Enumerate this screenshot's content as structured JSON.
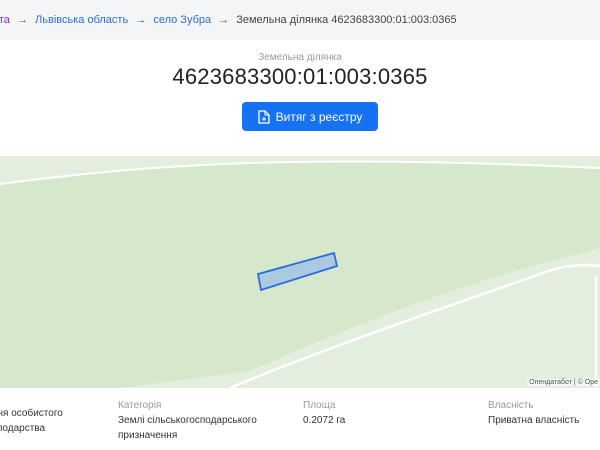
{
  "breadcrumb": {
    "items": [
      "ота",
      "Львівська область",
      "село Зубра"
    ],
    "current": "Земельна ділянка 4623683300:01:003:0365",
    "separator": "→"
  },
  "header": {
    "subtitle": "Земельна ділянка",
    "cadastral_number": "4623683300:01:003:0365",
    "extract_button_label": "Витяг з реєстру"
  },
  "map": {
    "attribution": "Опендатабот | © Ope"
  },
  "details": {
    "purpose": {
      "value_line1": "ння особистого",
      "value_line2": "сподарства"
    },
    "category": {
      "label": "Категорія",
      "value_line1": "Землі сільськогосподарського",
      "value_line2": "призначення"
    },
    "area": {
      "label": "Площа",
      "value": "0.2072 га"
    },
    "ownership": {
      "label": "Власність",
      "value": "Приватна власність"
    }
  },
  "colors": {
    "accent": "#1672f3",
    "parcel_fill": "#8fb4f0",
    "parcel_stroke": "#2a6be0",
    "map_field": "#e4eede",
    "map_forest": "#d6e8cc"
  }
}
